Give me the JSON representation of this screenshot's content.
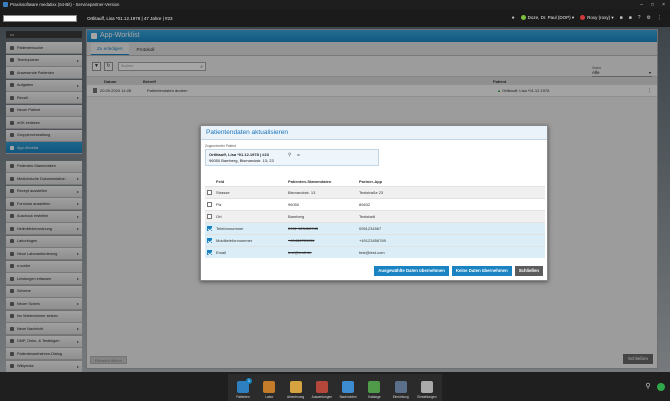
{
  "window": {
    "title": "Praxissoftware medatixx (64-Bit) - Servicepartner-Version"
  },
  "topbar": {
    "patient_header": "Ortlitauff, Lisa *01.12.1978 | 47 Jahre | #23",
    "doctor": "Doze, Dr. Paul (DOP)",
    "user": "Roxy (roxy)"
  },
  "sidebar": {
    "top_label": "•••",
    "items_group1": [
      {
        "label": "Patientensuche",
        "arrow": false
      },
      {
        "label": "Terminplaner",
        "arrow": true
      },
      {
        "label": "Anwesende Patienten",
        "arrow": false
      },
      {
        "label": "Aufgaben",
        "arrow": true
      },
      {
        "label": "Recall",
        "arrow": true
      },
      {
        "label": "Neuer Patient",
        "arrow": false
      },
      {
        "label": "eGK einlesen",
        "arrow": false
      },
      {
        "label": "Gruppenverwaltung",
        "arrow": false
      },
      {
        "label": "App-Worklist",
        "arrow": false,
        "active": true
      }
    ],
    "items_group2": [
      {
        "label": "Patienten-Stammdaten",
        "arrow": false
      },
      {
        "label": "Medizinische Dokumentation",
        "arrow": true
      },
      {
        "label": "Rezept ausstellen",
        "arrow": true
      },
      {
        "label": "Formular ausstellen",
        "arrow": true
      },
      {
        "label": "Ausdruck erstellen",
        "arrow": true
      },
      {
        "label": "Heilmittelverordnung",
        "arrow": true
      },
      {
        "label": "Laborbogen",
        "arrow": false
      },
      {
        "label": "Neue Laboranforderung",
        "arrow": true
      },
      {
        "label": "e.scribe",
        "arrow": false
      },
      {
        "label": "Leistungen erfassen",
        "arrow": true
      },
      {
        "label": "Scheine",
        "arrow": false
      },
      {
        "label": "Neuer Schein",
        "arrow": true
      },
      {
        "label": "Ins Wartezimmer setzen",
        "arrow": false
      },
      {
        "label": "Neue Nachricht",
        "arrow": true
      },
      {
        "label": "DMP, Onko- & Testbögen",
        "arrow": true
      },
      {
        "label": "Patientenaufnahme-Dialog",
        "arrow": false
      },
      {
        "label": "Wikipedia",
        "arrow": true
      }
    ]
  },
  "main": {
    "title": "App-Worklist",
    "tabs": [
      "Zu erledigen",
      "Protokoll"
    ],
    "search_placeholder": "Suchen",
    "filter_label": "Status",
    "filter_value": "Alle",
    "columns": [
      "Datum",
      "Betreff",
      "Patient"
    ],
    "rows": [
      {
        "date": "20.09.2024 14:28",
        "subject": "Patientendaten ändern",
        "patient": "Ortlitauff, Lisa *01.12.1978"
      }
    ],
    "prev_button": "Element öffnen",
    "close_button": "Schließen"
  },
  "dialog": {
    "title": "Patientendaten aktualisieren",
    "assigned_label": "Zugeordneter Patient",
    "patient_line1": "Ortlitauff, Lisa *01.12.1978 | #23",
    "patient_line2": "96050 Bamberg, Bismarckstr. 13; 23",
    "patient_sex": "w",
    "columns": [
      "Feld",
      "Patienten-Stammdaten",
      "Partner-App"
    ],
    "rows": [
      {
        "field": "Strasse",
        "master": "Bismarckstr. 13",
        "partner": "Teststraße 23",
        "checked": false,
        "strike": false
      },
      {
        "field": "Plz",
        "master": "96050",
        "partner": "89632",
        "checked": false,
        "strike": false
      },
      {
        "field": "Ort",
        "master": "Bamberg",
        "partner": "Teststadt",
        "checked": false,
        "strike": false
      },
      {
        "field": "Telefonnummer",
        "master": "0951 123456743",
        "partner": "0951234567",
        "checked": true,
        "strike": true
      },
      {
        "field": "Mobiltelefonnummer",
        "master": "+49456789011",
        "partner": "+49123456789",
        "checked": true,
        "strike": true
      },
      {
        "field": "Email",
        "master": "test@testt.de",
        "partner": "test@test.com",
        "checked": true,
        "strike": true
      }
    ],
    "btn_apply_selected": "Ausgewählte Daten übernehmen",
    "btn_apply_none": "Keine Daten übernehmen",
    "btn_close": "Schließen"
  },
  "dock": [
    {
      "label": "Patienten",
      "icon": "patients-icon",
      "color": "#2d7fc0",
      "badge": "1"
    },
    {
      "label": "Labor",
      "icon": "lab-icon",
      "color": "#c47b2a"
    },
    {
      "label": "Abrechnung",
      "icon": "billing-icon",
      "color": "#d6a341"
    },
    {
      "label": "Auswertungen",
      "icon": "stats-icon",
      "color": "#b5473a"
    },
    {
      "label": "Nachrichten",
      "icon": "messages-icon",
      "color": "#3d8bd0"
    },
    {
      "label": "Kataloge",
      "icon": "catalogs-icon",
      "color": "#4f9b4a"
    },
    {
      "label": "Einrichtung",
      "icon": "setup-icon",
      "color": "#5a6f8a"
    },
    {
      "label": "Einstellungen",
      "icon": "settings-icon",
      "color": "#aaaaaa"
    }
  ],
  "colors": {
    "accent": "#1a83c2",
    "status_ok": "#2fa84a",
    "doctor_dot": "#7bbf3a",
    "user_dot": "#d23a3a"
  }
}
